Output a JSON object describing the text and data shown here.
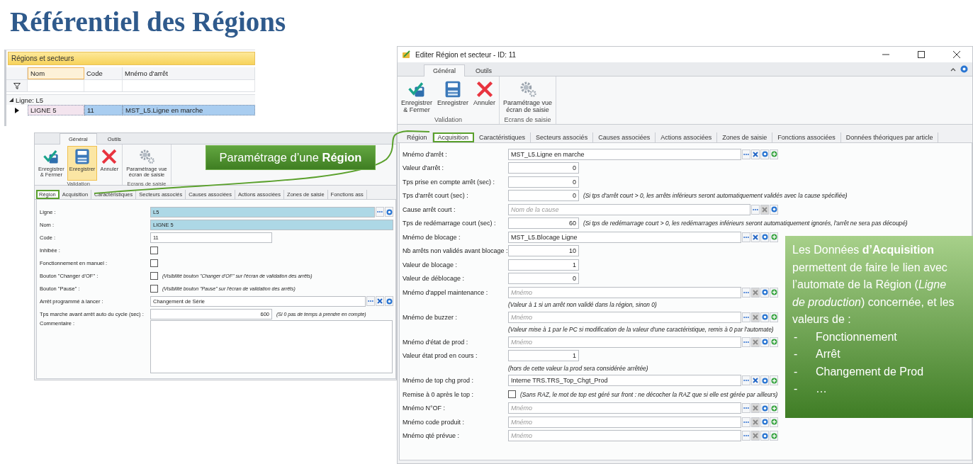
{
  "title": "Référentiel des Régions",
  "grid_window": {
    "title": "Régions et secteurs",
    "columns": [
      "Nom",
      "Code",
      "Mnémo d'arrêt"
    ],
    "group": "Ligne: L5",
    "rows": [
      {
        "cells": [
          "LIGNE 5",
          "11",
          "MST_L5.Ligne en marche"
        ],
        "selected": true
      }
    ]
  },
  "region_window": {
    "ribbon_tabs": [
      {
        "label": "Général",
        "selected": true
      },
      {
        "label": "Outils",
        "selected": false
      }
    ],
    "ribbon_groups": [
      {
        "label": "Validation",
        "buttons": [
          {
            "label": "Enregistrer\n& Fermer",
            "kind": "save-close",
            "hovered": false
          },
          {
            "label": "Enregistrer",
            "kind": "save",
            "hovered": true
          },
          {
            "label": "Annuler",
            "kind": "cancel",
            "hovered": false
          }
        ]
      },
      {
        "label": "Ecrans de saisie",
        "buttons": [
          {
            "label": "Paramétrage vue\nécran de saisie",
            "kind": "settings",
            "hovered": false
          }
        ]
      }
    ],
    "tabs": [
      {
        "label": "Région",
        "selected": true
      },
      {
        "label": "Acquisition",
        "selected": false
      },
      {
        "label": "Caractéristiques",
        "selected": false
      },
      {
        "label": "Secteurs associés",
        "selected": false
      },
      {
        "label": "Causes associées",
        "selected": false
      },
      {
        "label": "Actions associées",
        "selected": false
      },
      {
        "label": "Zones de saisie",
        "selected": false
      },
      {
        "label": "Fonctions ass",
        "selected": false
      }
    ],
    "fields": [
      {
        "label": "Ligne :",
        "kind": "lookup",
        "value": "L5",
        "highlighted": true,
        "clearable": false,
        "addable": false
      },
      {
        "label": "Nom :",
        "kind": "text",
        "value": "LIGNE 5",
        "highlighted": true
      },
      {
        "label": "Code :",
        "kind": "short-text",
        "value": "11",
        "highlighted": false
      },
      {
        "label": "Inhibée :",
        "kind": "check",
        "checked": false
      },
      {
        "label": "Fonctionnement en manuel :",
        "kind": "check",
        "checked": false
      },
      {
        "label": "Bouton \"Changer d'OF\" :",
        "kind": "check",
        "checked": false,
        "note": "(Visibilité bouton \"Changer d'OF\" sur l'écran de validation des arrêts)"
      },
      {
        "label": "Bouton \"Pause\" :",
        "kind": "check",
        "checked": false,
        "note": "(Visibilité bouton \"Pause\" sur l'écran de validation des arrêts)"
      },
      {
        "label": "Arrêt programmé à lancer :",
        "kind": "lookup",
        "value": "Changement de Série",
        "highlighted": false,
        "clearable": true,
        "addable": false
      },
      {
        "label": "Tps marche avant arrêt auto du cycle (sec) :",
        "kind": "number",
        "value": "600",
        "note": "(Si 0 pas de temps à prendre en compte)"
      },
      {
        "label": "Commentaire :",
        "kind": "memo"
      }
    ]
  },
  "acquisition_window": {
    "title": "Editer Région et secteur - ID: 11",
    "ribbon_tabs": [
      {
        "label": "Général",
        "selected": true
      },
      {
        "label": "Outils",
        "selected": false
      }
    ],
    "ribbon_groups": [
      {
        "label": "Validation",
        "buttons": [
          {
            "label": "Enregistrer\n& Fermer",
            "kind": "save-close",
            "hovered": false
          },
          {
            "label": "Enregistrer",
            "kind": "save",
            "hovered": false
          },
          {
            "label": "Annuler",
            "kind": "cancel",
            "hovered": false
          }
        ]
      },
      {
        "label": "Ecrans de saisie",
        "buttons": [
          {
            "label": "Paramétrage vue\nécran de saisie",
            "kind": "settings",
            "hovered": false
          }
        ]
      }
    ],
    "tabs": [
      {
        "label": "Région",
        "selected": false
      },
      {
        "label": "Acquisition",
        "selected": true
      },
      {
        "label": "Caractéristiques",
        "selected": false
      },
      {
        "label": "Secteurs associés",
        "selected": false
      },
      {
        "label": "Causes associées",
        "selected": false
      },
      {
        "label": "Actions associées",
        "selected": false
      },
      {
        "label": "Zones de saisie",
        "selected": false
      },
      {
        "label": "Fonctions associées",
        "selected": false
      },
      {
        "label": "Données théoriques par article",
        "selected": false
      }
    ],
    "fields": [
      {
        "label": "Mnémo d'arrêt :",
        "kind": "lookup",
        "value": "MST_L5.Ligne en marche",
        "clearable": true,
        "addable": true,
        "clear_disabled": false
      },
      {
        "label": "Valeur d'arrêt :",
        "kind": "number",
        "value": "0"
      },
      {
        "label": "Tps prise en compte arrêt (sec) :",
        "kind": "number",
        "value": "0"
      },
      {
        "label": "Tps d'arrêt court (sec) :",
        "kind": "number",
        "value": "0",
        "note": "(Si tps d'arrêt court > 0, les arrêts inférieurs seront automatiquement validés avec la cause spécifiée)"
      },
      {
        "label": "Cause arrêt court :",
        "kind": "lookup",
        "placeholder": "Nom de la cause",
        "clearable": true,
        "addable": false,
        "clear_disabled": true
      },
      {
        "label": "Tps de redémarrage court (sec) :",
        "kind": "number",
        "value": "60",
        "note": "(Si tps de redémarrage court > 0, les redémarrages inférieurs seront automatiquement ignorés, l'arrêt ne sera pas découpé)"
      },
      {
        "label": "Mnémo de blocage :",
        "kind": "lookup",
        "value": "MST_L5.Blocage Ligne",
        "clearable": true,
        "addable": true,
        "clear_disabled": false
      },
      {
        "label": "Nb arrêts non validés avant blocage :",
        "kind": "number",
        "value": "10"
      },
      {
        "label": "Valeur de blocage :",
        "kind": "number",
        "value": "1"
      },
      {
        "label": "Valeur de déblocage :",
        "kind": "number",
        "value": "0"
      },
      {
        "label": "Mnémo d'appel maintenance :",
        "kind": "lookup",
        "placeholder": "Mnémo",
        "clearable": true,
        "addable": true,
        "clear_disabled": true,
        "hint": "(Valeur à 1 si un arrêt non validé dans la région, sinon 0)"
      },
      {
        "label": "Mnémo de buzzer :",
        "kind": "lookup",
        "placeholder": "Mnémo",
        "clearable": true,
        "addable": true,
        "clear_disabled": true,
        "hint": "(Valeur mise à 1 par le PC si modification de la valeur d'une caractéristique, remis à 0 par l'automate)"
      },
      {
        "label": "Mnémo d'état de prod :",
        "kind": "lookup",
        "placeholder": "Mnémo",
        "clearable": true,
        "addable": true,
        "clear_disabled": true
      },
      {
        "label": "Valeur état prod en cours :",
        "kind": "number",
        "value": "1",
        "hint": "(hors de cette valeur la prod sera considérée arrêtée)"
      },
      {
        "label": "Mnémo de top chg prod :",
        "kind": "lookup",
        "value": "Interne TRS.TRS_Top_Chgt_Prod",
        "clearable": true,
        "addable": true,
        "clear_disabled": false
      },
      {
        "label": "Remise à 0 après le top :",
        "kind": "check",
        "checked": false,
        "note": "(Sans RAZ, le mot de top est géré sur front : ne décocher la RAZ que si elle est gérée par ailleurs)"
      },
      {
        "label": "Mnémo N°OF :",
        "kind": "lookup",
        "placeholder": "Mnémo",
        "clearable": true,
        "addable": true,
        "clear_disabled": true
      },
      {
        "label": "Mnémo code produit :",
        "kind": "lookup",
        "placeholder": "Mnémo",
        "clearable": true,
        "addable": true,
        "clear_disabled": true
      },
      {
        "label": "Mnémo qté prévue :",
        "kind": "lookup",
        "placeholder": "Mnémo",
        "clearable": true,
        "addable": true,
        "clear_disabled": true
      }
    ]
  },
  "region_callout": "Paramétrage d’une **Région**",
  "acquisition_callout": {
    "text": "Les Données **d’Acquisition** permettent de faire le lien avec l’automate de la Région (*Ligne de production*) concernée, et les valeurs de :",
    "items": [
      {
        "marker": "-",
        "text": "Fonctionnement"
      },
      {
        "marker": "-",
        "text": "Arrêt"
      },
      {
        "marker": "-",
        "text": "Changement de Prod"
      },
      {
        "marker": "-",
        "text": "…"
      }
    ]
  }
}
